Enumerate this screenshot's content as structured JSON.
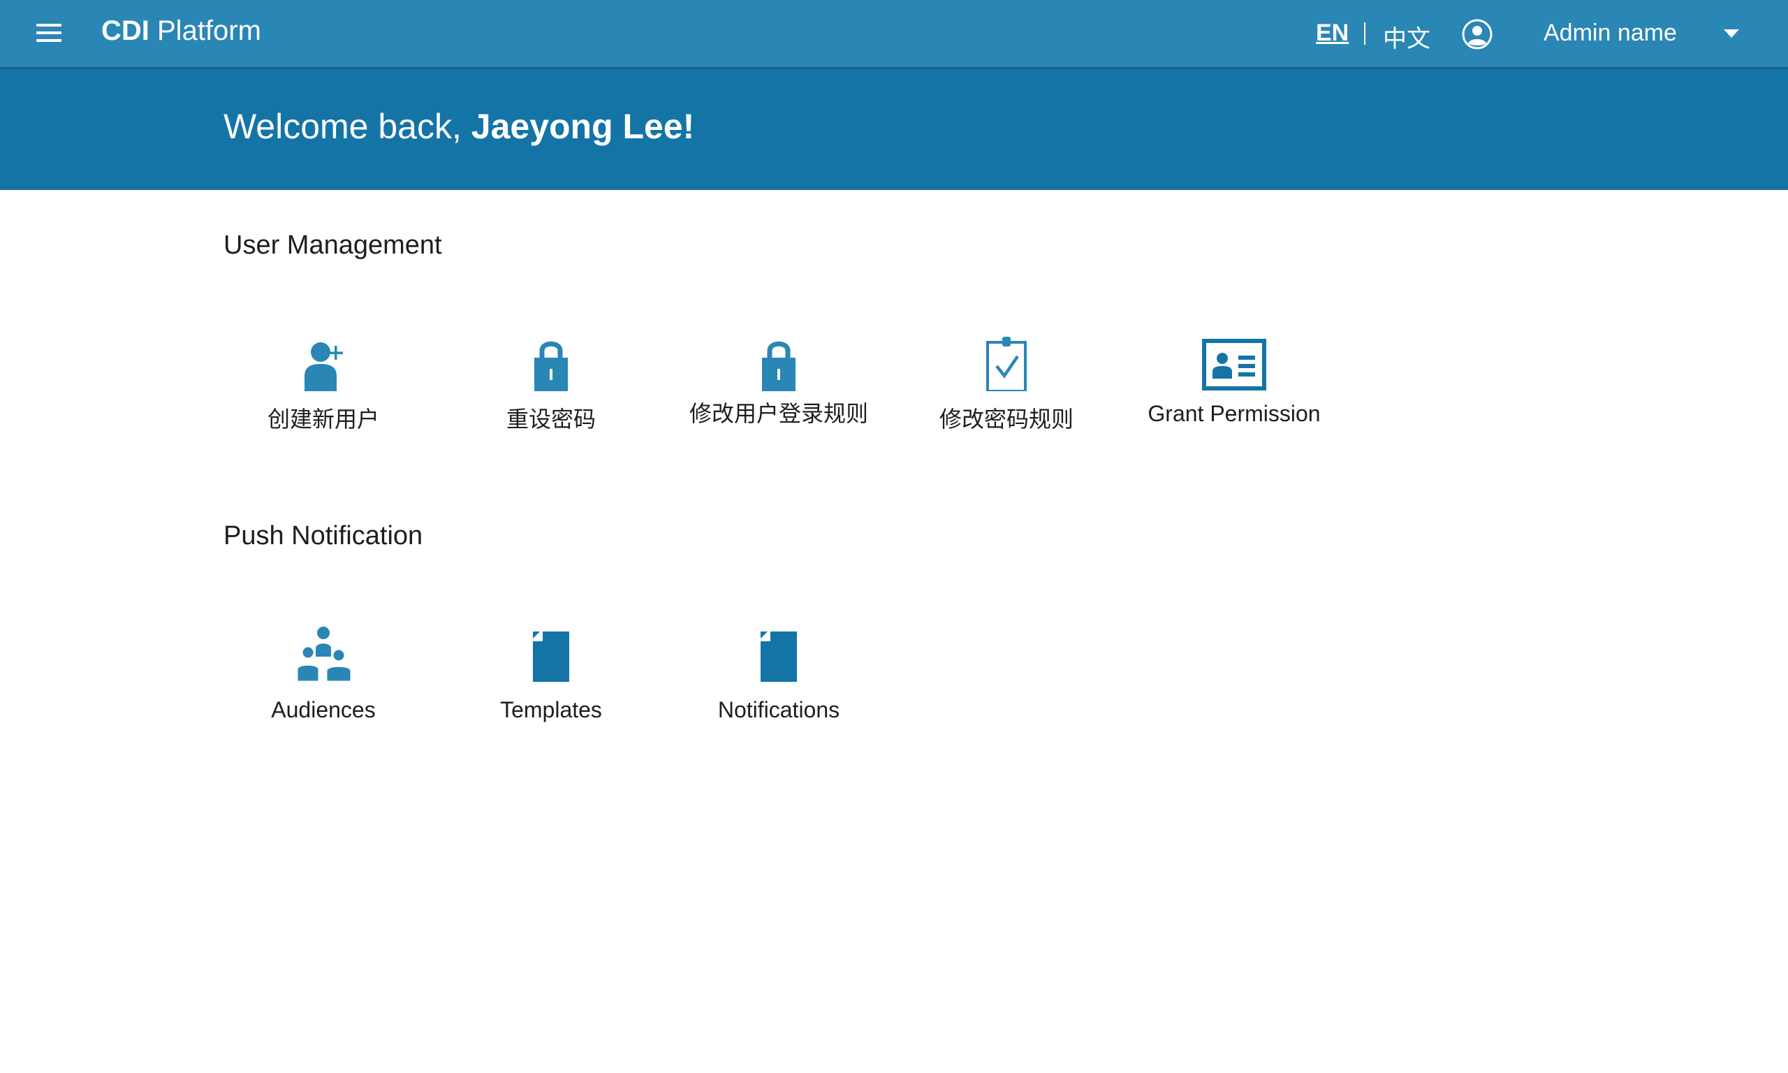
{
  "header": {
    "app_title_bold": "CDI",
    "app_title_rest": " Platform",
    "lang_en": "EN",
    "lang_zh": "中文",
    "admin_name": "Admin name"
  },
  "banner": {
    "greeting": "Welcome back, ",
    "user_name": "Jaeyong Lee!"
  },
  "sections": {
    "user_management": {
      "title": "User Management",
      "tiles": [
        {
          "label": "创建新用户",
          "icon": "add-user-icon"
        },
        {
          "label": "重设密码",
          "icon": "lock-icon"
        },
        {
          "label": "修改用户登录规则",
          "icon": "lock-icon"
        },
        {
          "label": "修改密码规则",
          "icon": "clipboard-check-icon"
        },
        {
          "label": "Grant Permission",
          "icon": "id-card-icon"
        }
      ]
    },
    "push_notification": {
      "title": "Push Notification",
      "tiles": [
        {
          "label": "Audiences",
          "icon": "group-icon"
        },
        {
          "label": "Templates",
          "icon": "document-icon"
        },
        {
          "label": "Notifications",
          "icon": "document-icon"
        }
      ]
    }
  },
  "colors": {
    "topbar": "#2a86b5",
    "banner": "#1474a6",
    "icon": "#2a86b5"
  }
}
